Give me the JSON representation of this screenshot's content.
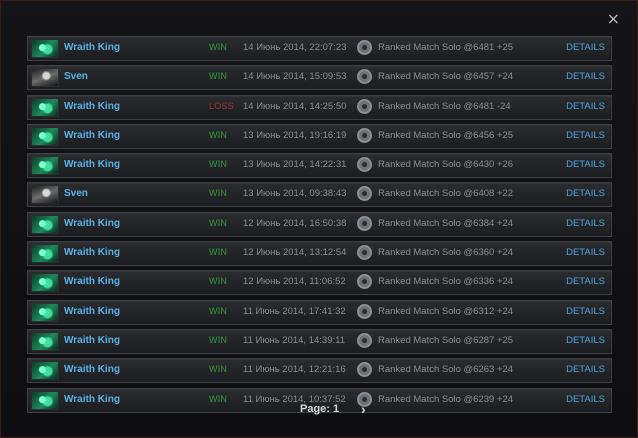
{
  "dialog": {
    "close_glyph": "×"
  },
  "matches": [
    {
      "hero": "Wraith King",
      "portrait": "wk",
      "result": "WIN",
      "result_class": "win",
      "date": "14 Июнь 2014, 22:07:23",
      "mode": "Ranked Match Solo @6481 +25",
      "details": "DETAILS"
    },
    {
      "hero": "Sven",
      "portrait": "sven",
      "result": "WIN",
      "result_class": "win",
      "date": "14 Июнь 2014, 15:09:53",
      "mode": "Ranked Match Solo @6457 +24",
      "details": "DETAILS"
    },
    {
      "hero": "Wraith King",
      "portrait": "wk",
      "result": "LOSS",
      "result_class": "loss",
      "date": "14 Июнь 2014, 14:25:50",
      "mode": "Ranked Match Solo @6481 -24",
      "details": "DETAILS"
    },
    {
      "hero": "Wraith King",
      "portrait": "wk",
      "result": "WIN",
      "result_class": "win",
      "date": "13 Июнь 2014, 19:16:19",
      "mode": "Ranked Match Solo @6456 +25",
      "details": "DETAILS"
    },
    {
      "hero": "Wraith King",
      "portrait": "wk",
      "result": "WIN",
      "result_class": "win",
      "date": "13 Июнь 2014, 14:22:31",
      "mode": "Ranked Match Solo @6430 +26",
      "details": "DETAILS"
    },
    {
      "hero": "Sven",
      "portrait": "sven",
      "result": "WIN",
      "result_class": "win",
      "date": "13 Июнь 2014, 09:38:43",
      "mode": "Ranked Match Solo @6408 +22",
      "details": "DETAILS"
    },
    {
      "hero": "Wraith King",
      "portrait": "wk",
      "result": "WIN",
      "result_class": "win",
      "date": "12 Июнь 2014, 16:50:38",
      "mode": "Ranked Match Solo @6384 +24",
      "details": "DETAILS"
    },
    {
      "hero": "Wraith King",
      "portrait": "wk",
      "result": "WIN",
      "result_class": "win",
      "date": "12 Июнь 2014, 13:12:54",
      "mode": "Ranked Match Solo @6360 +24",
      "details": "DETAILS"
    },
    {
      "hero": "Wraith King",
      "portrait": "wk",
      "result": "WIN",
      "result_class": "win",
      "date": "12 Июнь 2014, 11:06:52",
      "mode": "Ranked Match Solo @6336 +24",
      "details": "DETAILS"
    },
    {
      "hero": "Wraith King",
      "portrait": "wk",
      "result": "WIN",
      "result_class": "win",
      "date": "11 Июнь 2014, 17:41:32",
      "mode": "Ranked Match Solo @6312 +24",
      "details": "DETAILS"
    },
    {
      "hero": "Wraith King",
      "portrait": "wk",
      "result": "WIN",
      "result_class": "win",
      "date": "11 Июнь 2014, 14:39:11",
      "mode": "Ranked Match Solo @6287 +25",
      "details": "DETAILS"
    },
    {
      "hero": "Wraith King",
      "portrait": "wk",
      "result": "WIN",
      "result_class": "win",
      "date": "11 Июнь 2014, 12:21:16",
      "mode": "Ranked Match Solo @6263 +24",
      "details": "DETAILS"
    },
    {
      "hero": "Wraith King",
      "portrait": "wk",
      "result": "WIN",
      "result_class": "win",
      "date": "11 Июнь 2014, 10:37:52",
      "mode": "Ranked Match Solo @6239 +24",
      "details": "DETAILS"
    }
  ],
  "pager": {
    "label": "Page: 1",
    "next_glyph": "›"
  },
  "colors": {
    "hero_name": "#5ab3e8",
    "win": "#2f9a3a",
    "loss": "#a8312a",
    "details_link": "#4da3dd"
  },
  "icons": {
    "close": "close-icon",
    "game_mode": "ranked-mode-icon",
    "next_page": "chevron-right-icon"
  }
}
